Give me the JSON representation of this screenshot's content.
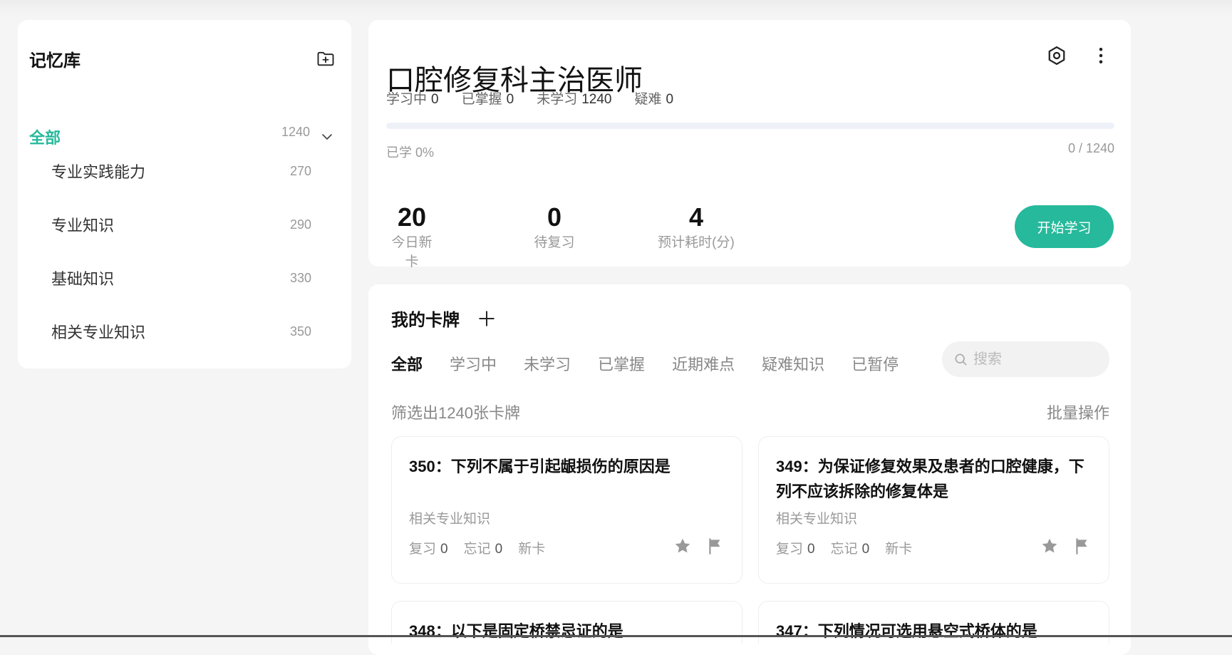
{
  "sidebar": {
    "title": "记忆库",
    "all": {
      "label": "全部",
      "count": "1240"
    },
    "items": [
      {
        "label": "专业实践能力",
        "count": "270"
      },
      {
        "label": "专业知识",
        "count": "290"
      },
      {
        "label": "基础知识",
        "count": "330"
      },
      {
        "label": "相关专业知识",
        "count": "350"
      }
    ]
  },
  "deck": {
    "title": "口腔修复科主治医师",
    "stats": [
      {
        "label": "学习中",
        "value": "0"
      },
      {
        "label": "已掌握",
        "value": "0"
      },
      {
        "label": "未学习",
        "value": "1240"
      },
      {
        "label": "疑难",
        "value": "0"
      }
    ],
    "progress_fraction": 0,
    "progress_label": "已学 0%",
    "progress_count": "0 / 1240",
    "metrics": [
      {
        "value": "20",
        "label": "今日新卡"
      },
      {
        "value": "0",
        "label": "待复习"
      },
      {
        "value": "4",
        "label": "预计耗时(分)"
      }
    ],
    "start_label": "开始学习"
  },
  "cards": {
    "title": "我的卡牌",
    "tabs": [
      "全部",
      "学习中",
      "未学习",
      "已掌握",
      "近期难点",
      "疑难知识",
      "已暂停"
    ],
    "search_placeholder": "搜索",
    "summary": "筛选出1240张卡牌",
    "batch_label": "批量操作",
    "review_label": "复习",
    "forget_label": "忘记",
    "items": [
      {
        "title": "350：下列不属于引起龈损伤的原因是",
        "category": "相关专业知识",
        "review": "0",
        "forget": "0",
        "status": "新卡"
      },
      {
        "title": "349：为保证修复效果及患者的口腔健康，下列不应该拆除的修复体是",
        "category": "相关专业知识",
        "review": "0",
        "forget": "0",
        "status": "新卡"
      },
      {
        "title": "348：以下是固定桥禁忌证的是"
      },
      {
        "title": "347：下列情况可选用悬空式桥体的是"
      }
    ]
  },
  "colors": {
    "accent": "#26b99b",
    "icon_gray": "#999999"
  }
}
